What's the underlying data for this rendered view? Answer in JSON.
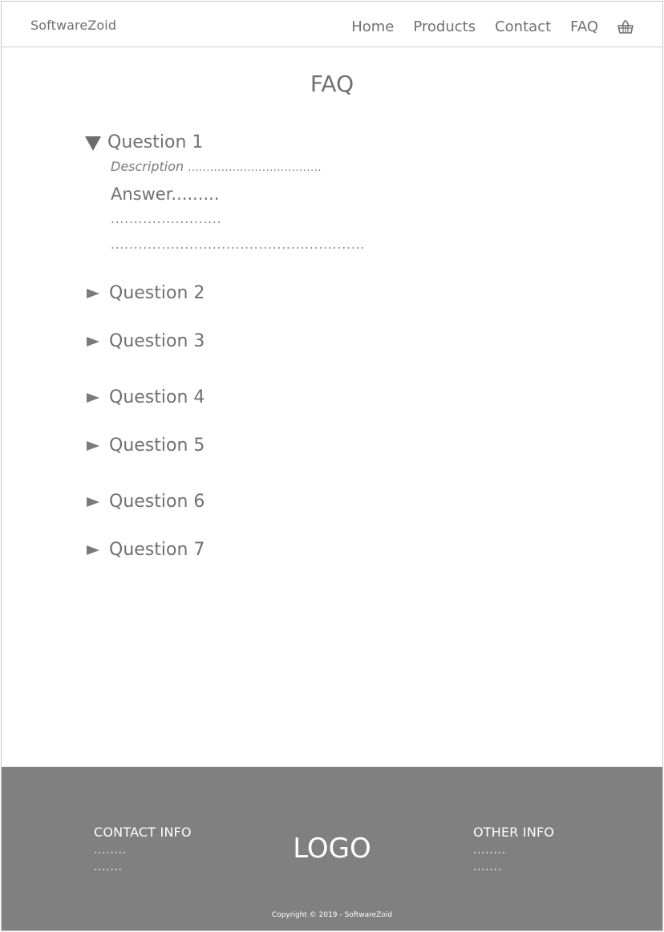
{
  "header": {
    "brand": "SoftwareZoid",
    "nav": [
      "Home",
      "Products",
      "Contact",
      "FAQ"
    ],
    "cart_icon": "basket-icon"
  },
  "page_title": "FAQ",
  "faq": {
    "open_question": {
      "label": "Question 1",
      "description_label": "Description",
      "description_dots": "....................................",
      "answer_label": "Answer.........",
      "answer_lines": [
        "........................",
        "......................................................."
      ]
    },
    "questions": [
      "Question 2",
      "Question 3",
      "Question 4",
      "Question 5",
      "Question 6",
      "Question 7"
    ]
  },
  "footer": {
    "contact_title": "CONTACT INFO",
    "contact_lines": [
      "........",
      "......."
    ],
    "logo": "LOGO",
    "other_title": "OTHER INFO",
    "other_lines": [
      "........",
      "......."
    ],
    "copyright": "Copyright © 2019 - SoftwareZoid",
    "background_color": "#808080"
  }
}
